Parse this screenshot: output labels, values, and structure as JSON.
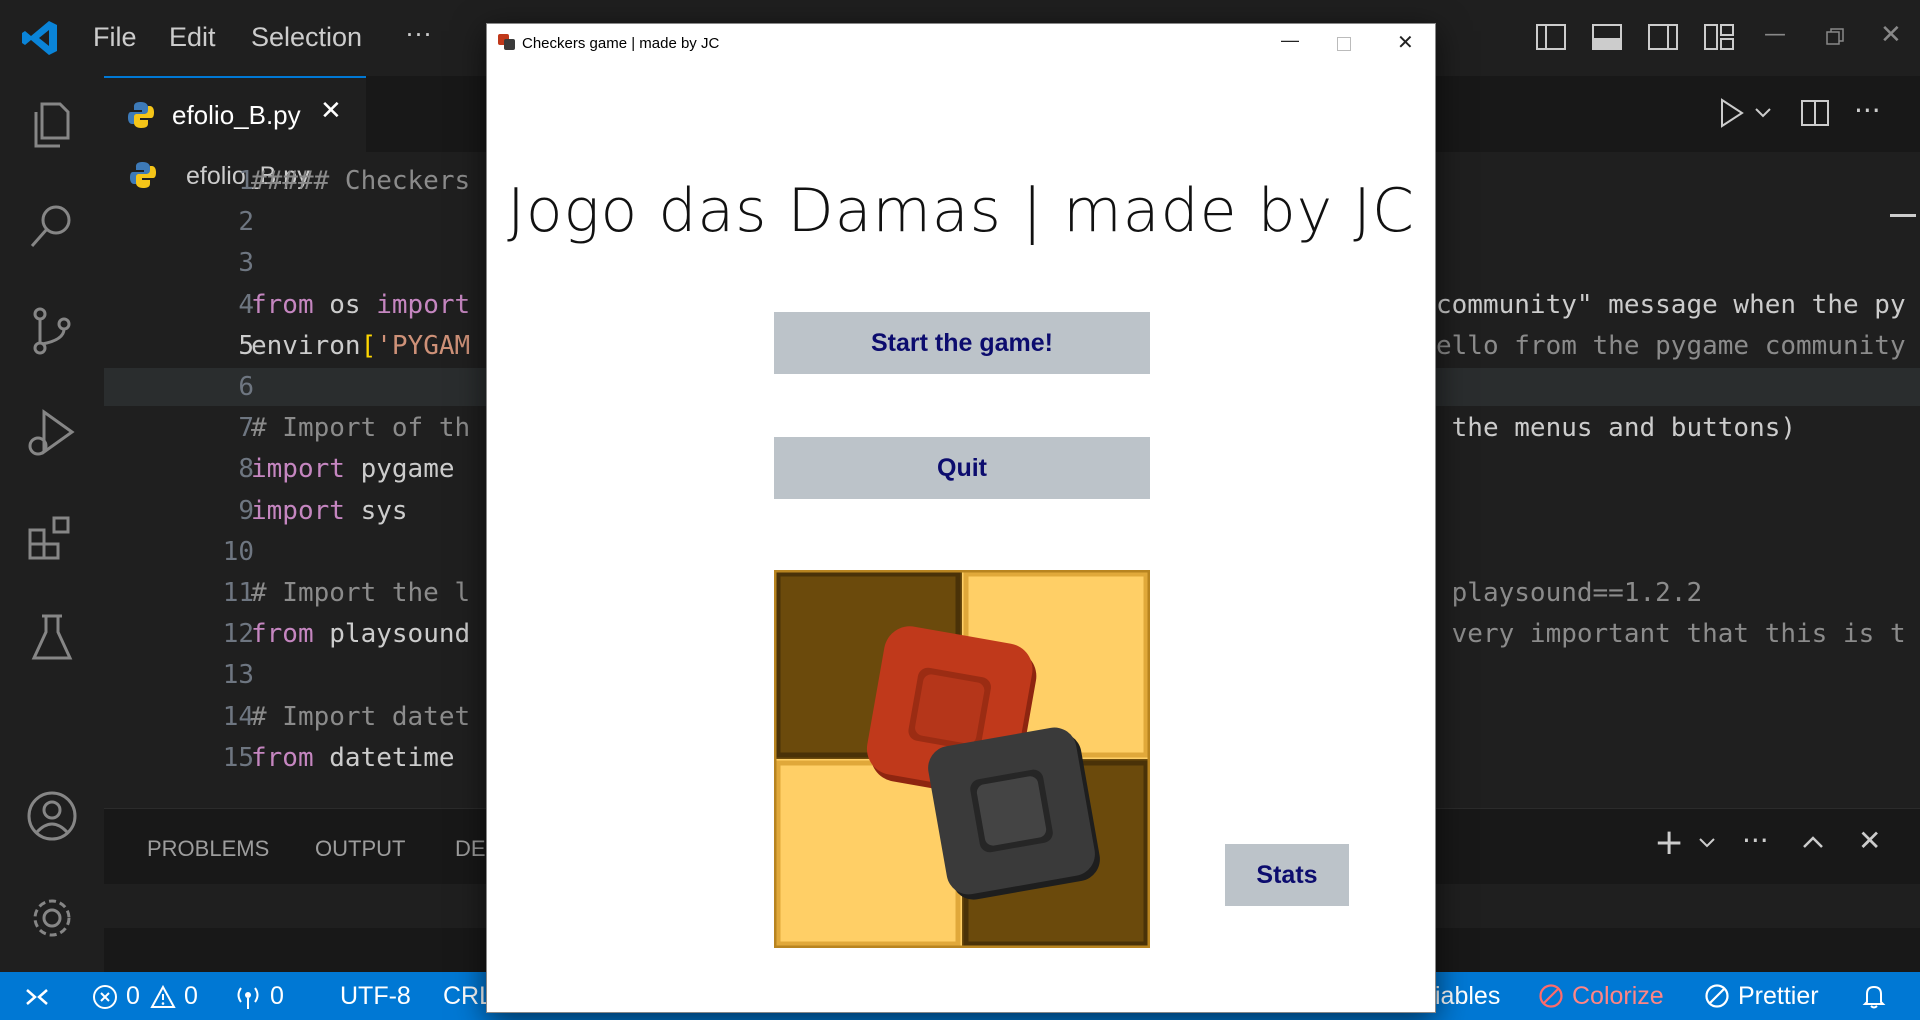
{
  "menu": {
    "file": "File",
    "edit": "Edit",
    "selection": "Selection",
    "more": "···"
  },
  "editor_tab": {
    "filename": "efolio_B.py",
    "close": "✕"
  },
  "breadcrumb": {
    "filename": "efolio_B.py"
  },
  "code_lines": [
    {
      "n": "1",
      "segments": [
        {
          "t": "##### Checkers",
          "c": "cm2"
        }
      ],
      "right": []
    },
    {
      "n": "2",
      "segments": [],
      "right": []
    },
    {
      "n": "3",
      "segments": [],
      "right": []
    },
    {
      "n": "4",
      "segments": [
        {
          "t": "from",
          "c": "kw"
        },
        {
          "t": " os ",
          "c": ""
        },
        {
          "t": "import",
          "c": "kw"
        }
      ],
      "right": [
        {
          "t": "community\" message when the py",
          "c": ""
        }
      ]
    },
    {
      "n": "5",
      "segments": [
        {
          "t": "environ",
          "c": ""
        },
        {
          "t": "[",
          "c": "br"
        },
        {
          "t": "'PYGAM",
          "c": "str"
        }
      ],
      "right": [
        {
          "t": "ello from the pygame community",
          "c": "cm2"
        }
      ]
    },
    {
      "n": "6",
      "segments": [],
      "right": []
    },
    {
      "n": "7",
      "segments": [
        {
          "t": "# Import of th",
          "c": "cm2"
        }
      ],
      "right": [
        {
          "t": " the menus and buttons)",
          "c": ""
        }
      ]
    },
    {
      "n": "8",
      "segments": [
        {
          "t": "import",
          "c": "kw"
        },
        {
          "t": " pygame ",
          "c": ""
        }
      ],
      "right": []
    },
    {
      "n": "9",
      "segments": [
        {
          "t": "import",
          "c": "kw"
        },
        {
          "t": " sys",
          "c": ""
        }
      ],
      "right": []
    },
    {
      "n": "10",
      "segments": [],
      "right": []
    },
    {
      "n": "11",
      "segments": [
        {
          "t": "# Import the l",
          "c": "cm2"
        }
      ],
      "right": [
        {
          "t": " playsound==1.2.2",
          "c": "cm2"
        }
      ]
    },
    {
      "n": "12",
      "segments": [
        {
          "t": "from",
          "c": "kw"
        },
        {
          "t": " playsound",
          "c": ""
        }
      ],
      "right": [
        {
          "t": " very important that this is t",
          "c": "cm2"
        }
      ]
    },
    {
      "n": "13",
      "segments": [],
      "right": []
    },
    {
      "n": "14",
      "segments": [
        {
          "t": "# Import datet",
          "c": "cm2"
        }
      ],
      "right": []
    },
    {
      "n": "15",
      "segments": [
        {
          "t": "from",
          "c": "kw"
        },
        {
          "t": " datetime ",
          "c": ""
        }
      ],
      "right": []
    }
  ],
  "panel": {
    "tabs": [
      "PROBLEMS",
      "OUTPUT",
      "DE"
    ]
  },
  "statusbar": {
    "errors": "0",
    "warnings": "0",
    "ports": "0",
    "encoding": "UTF-8",
    "eol": "CRL",
    "variables": "iables",
    "colorize": "Colorize",
    "prettier": "Prettier"
  },
  "game_window": {
    "title": "Checkers game | made by JC",
    "heading": "Jogo das Damas | made by JC",
    "start_label": "Start the game!",
    "quit_label": "Quit",
    "stats_label": "Stats"
  },
  "colors": {
    "accent": "#0078d4",
    "board_dark": "#6b4a0c",
    "board_light": "#ffcf66",
    "piece_red": "#c0391b",
    "piece_black": "#3a3a3a",
    "button_bg": "#bcc3c9",
    "button_text": "#0c0c6e"
  }
}
